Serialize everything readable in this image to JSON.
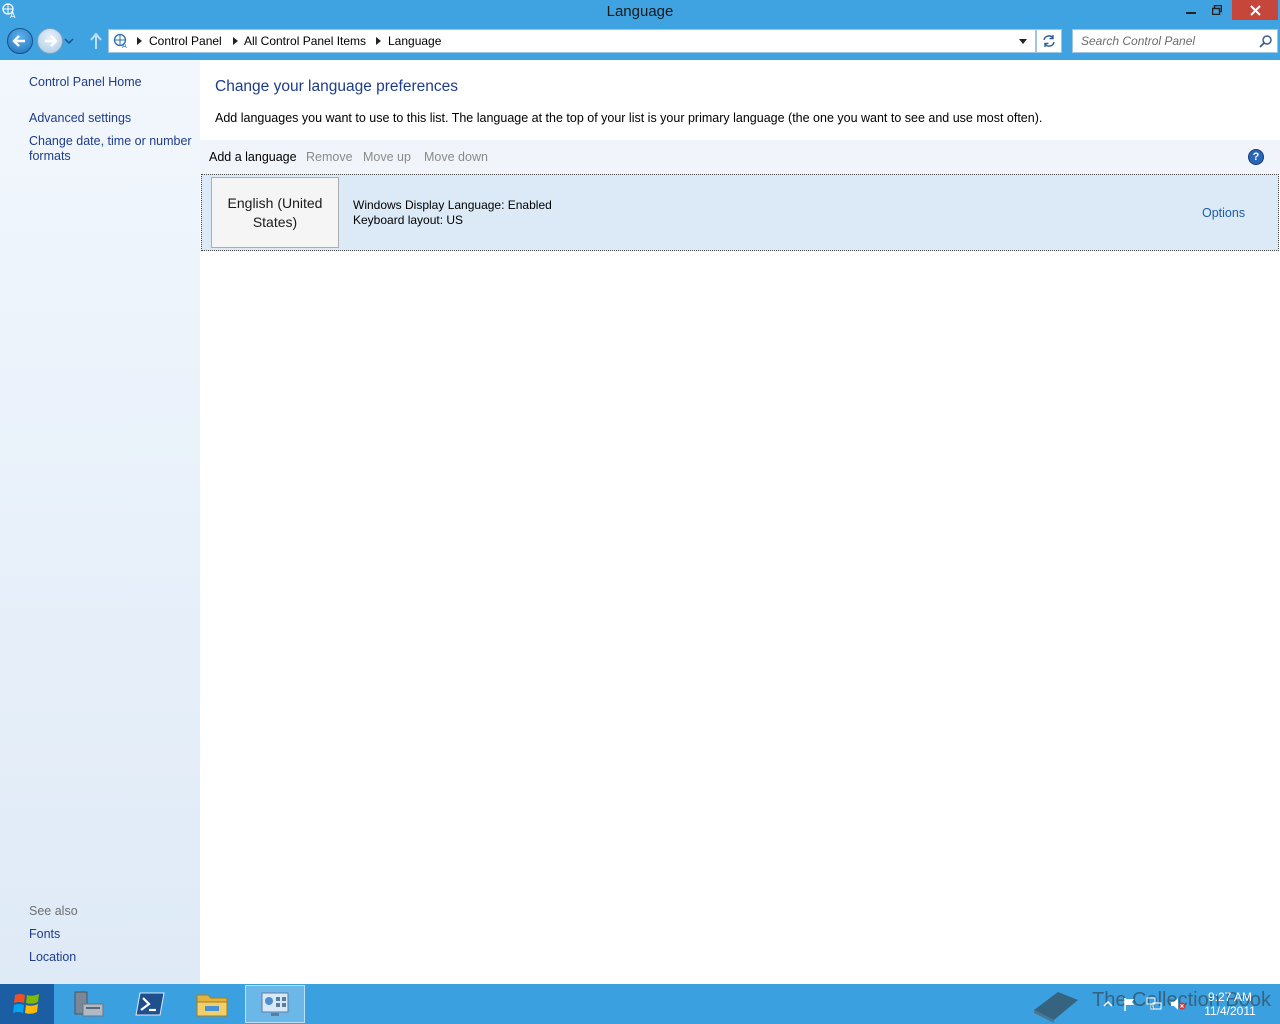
{
  "window": {
    "title": "Language",
    "app_icon": "language-globe-icon",
    "controls": {
      "minimize": "minimize-icon",
      "restore": "restore-icon",
      "close": "close-icon"
    }
  },
  "navbar": {
    "breadcrumbs": [
      "Control Panel",
      "All Control Panel Items",
      "Language"
    ],
    "search_placeholder": "Search Control Panel"
  },
  "sidebar": {
    "home": "Control Panel Home",
    "links": [
      "Advanced settings",
      "Change date, time or number",
      "formats"
    ],
    "see_also_label": "See also",
    "see_also": [
      "Fonts",
      "Location"
    ]
  },
  "main": {
    "title": "Change your language preferences",
    "description": "Add languages you want to use to this list. The language at the top of your list is your primary language (the one you want to see and use most often).",
    "toolbar": {
      "add": "Add a language",
      "remove": "Remove",
      "move_up": "Move up",
      "move_down": "Move down",
      "help": "?"
    },
    "languages": [
      {
        "name": "English (United States)",
        "display_language": "Windows Display Language: Enabled",
        "keyboard": "Keyboard layout: US",
        "options": "Options"
      }
    ]
  },
  "taskbar": {
    "apps": [
      "server-manager-icon",
      "powershell-icon",
      "file-explorer-icon",
      "control-panel-icon"
    ],
    "tray": [
      "show-hidden-icons-icon",
      "action-center-flag-icon",
      "network-icon",
      "volume-muted-icon"
    ],
    "time": "9:27 AM",
    "date": "11/4/2011",
    "watermark": "The Collection Book"
  },
  "colors": {
    "chrome": "#3ea3e0",
    "link": "#1e3c8c",
    "close": "#c7463b",
    "selection": "#dceaf8"
  }
}
